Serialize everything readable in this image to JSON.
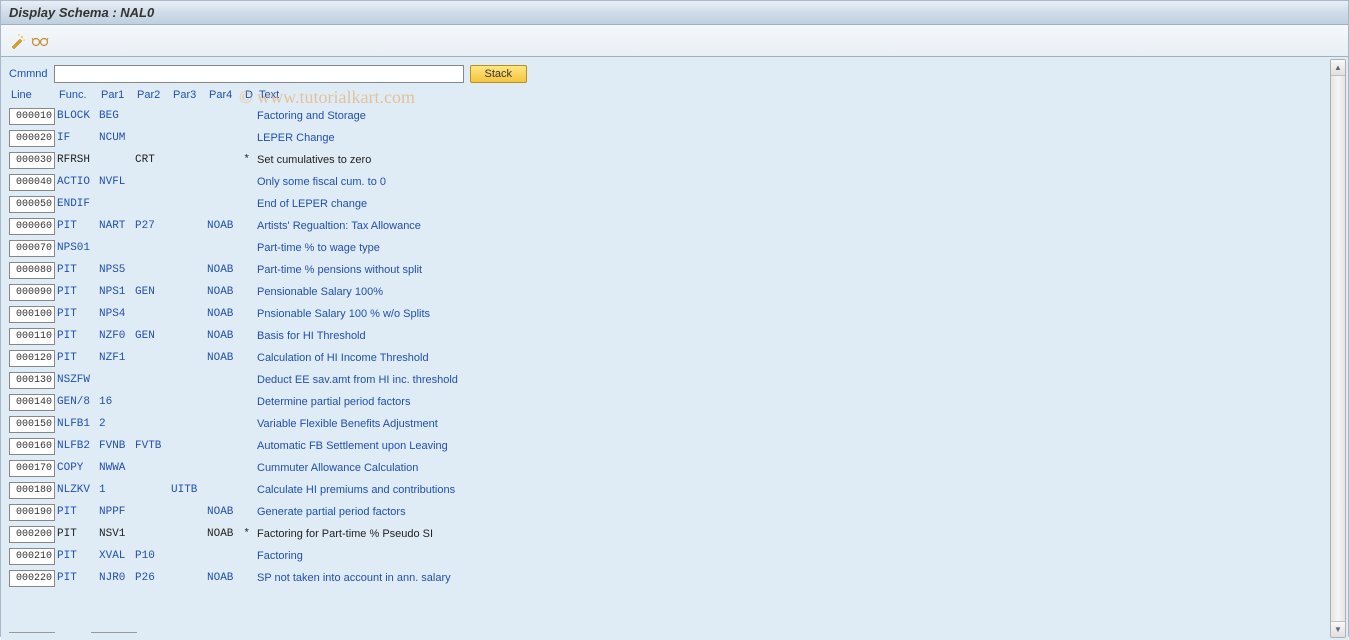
{
  "title": "Display Schema : NAL0",
  "watermark": "© www.tutorialkart.com",
  "command": {
    "label": "Cmmnd",
    "value": "",
    "stack_label": "Stack"
  },
  "headers": {
    "line": "Line",
    "func": "Func.",
    "par1": "Par1",
    "par2": "Par2",
    "par3": "Par3",
    "par4": "Par4",
    "d": "D",
    "text": "Text"
  },
  "rows": [
    {
      "line": "000010",
      "func": "BLOCK",
      "par1": "BEG",
      "par2": "",
      "par3": "",
      "par4": "",
      "d": "",
      "text": "Factoring and Storage",
      "muted": false
    },
    {
      "line": "000020",
      "func": "IF",
      "par1": "NCUM",
      "par2": "",
      "par3": "",
      "par4": "",
      "d": "",
      "text": "LEPER Change",
      "muted": false
    },
    {
      "line": "000030",
      "func": "RFRSH",
      "par1": "",
      "par2": "CRT",
      "par3": "",
      "par4": "",
      "d": "*",
      "text": "Set cumulatives to zero",
      "muted": true
    },
    {
      "line": "000040",
      "func": "ACTIO",
      "par1": "NVFL",
      "par2": "",
      "par3": "",
      "par4": "",
      "d": "",
      "text": "Only some fiscal cum. to 0",
      "muted": false
    },
    {
      "line": "000050",
      "func": "ENDIF",
      "par1": "",
      "par2": "",
      "par3": "",
      "par4": "",
      "d": "",
      "text": "End of LEPER change",
      "muted": false
    },
    {
      "line": "000060",
      "func": "PIT",
      "par1": "NART",
      "par2": "P27",
      "par3": "",
      "par4": "NOAB",
      "d": "",
      "text": "Artists' Regualtion: Tax Allowance",
      "muted": false
    },
    {
      "line": "000070",
      "func": "NPS01",
      "par1": "",
      "par2": "",
      "par3": "",
      "par4": "",
      "d": "",
      "text": "Part-time % to wage type",
      "muted": false
    },
    {
      "line": "000080",
      "func": "PIT",
      "par1": "NPS5",
      "par2": "",
      "par3": "",
      "par4": "NOAB",
      "d": "",
      "text": "Part-time % pensions without split",
      "muted": false
    },
    {
      "line": "000090",
      "func": "PIT",
      "par1": "NPS1",
      "par2": "GEN",
      "par3": "",
      "par4": "NOAB",
      "d": "",
      "text": "Pensionable Salary 100%",
      "muted": false
    },
    {
      "line": "000100",
      "func": "PIT",
      "par1": "NPS4",
      "par2": "",
      "par3": "",
      "par4": "NOAB",
      "d": "",
      "text": "Pnsionable Salary 100 % w/o Splits",
      "muted": false
    },
    {
      "line": "000110",
      "func": "PIT",
      "par1": "NZF0",
      "par2": "GEN",
      "par3": "",
      "par4": "NOAB",
      "d": "",
      "text": "Basis for HI Threshold",
      "muted": false
    },
    {
      "line": "000120",
      "func": "PIT",
      "par1": "NZF1",
      "par2": "",
      "par3": "",
      "par4": "NOAB",
      "d": "",
      "text": "Calculation of HI Income Threshold",
      "muted": false
    },
    {
      "line": "000130",
      "func": "NSZFW",
      "par1": "",
      "par2": "",
      "par3": "",
      "par4": "",
      "d": "",
      "text": "Deduct EE sav.amt from HI inc. threshold",
      "muted": false
    },
    {
      "line": "000140",
      "func": "GEN/8",
      "par1": "16",
      "par2": "",
      "par3": "",
      "par4": "",
      "d": "",
      "text": "Determine partial period factors",
      "muted": false
    },
    {
      "line": "000150",
      "func": "NLFB1",
      "par1": "2",
      "par2": "",
      "par3": "",
      "par4": "",
      "d": "",
      "text": "Variable Flexible Benefits Adjustment",
      "muted": false
    },
    {
      "line": "000160",
      "func": "NLFB2",
      "par1": "FVNB",
      "par2": "FVTB",
      "par3": "",
      "par4": "",
      "d": "",
      "text": "Automatic FB Settlement upon Leaving",
      "muted": false
    },
    {
      "line": "000170",
      "func": "COPY",
      "par1": "NWWA",
      "par2": "",
      "par3": "",
      "par4": "",
      "d": "",
      "text": "Cummuter Allowance Calculation",
      "muted": false
    },
    {
      "line": "000180",
      "func": "NLZKV",
      "par1": "1",
      "par2": "",
      "par3": "UITB",
      "par4": "",
      "d": "",
      "text": "Calculate HI premiums and contributions",
      "muted": false
    },
    {
      "line": "000190",
      "func": "PIT",
      "par1": "NPPF",
      "par2": "",
      "par3": "",
      "par4": "NOAB",
      "d": "",
      "text": "Generate partial period factors",
      "muted": false
    },
    {
      "line": "000200",
      "func": "PIT",
      "par1": "NSV1",
      "par2": "",
      "par3": "",
      "par4": "NOAB",
      "d": "*",
      "text": "Factoring for Part-time % Pseudo SI",
      "muted": true
    },
    {
      "line": "000210",
      "func": "PIT",
      "par1": "XVAL",
      "par2": "P10",
      "par3": "",
      "par4": "",
      "d": "",
      "text": "Factoring",
      "muted": false
    },
    {
      "line": "000220",
      "func": "PIT",
      "par1": "NJR0",
      "par2": "P26",
      "par3": "",
      "par4": "NOAB",
      "d": "",
      "text": "SP not taken into account in ann. salary",
      "muted": false
    }
  ]
}
